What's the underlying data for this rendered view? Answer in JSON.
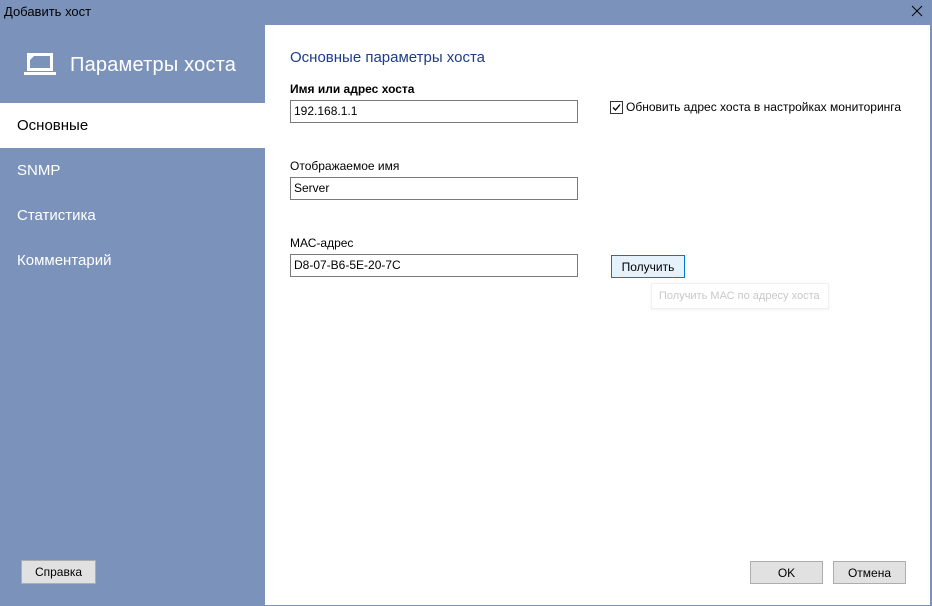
{
  "window": {
    "title": "Добавить хост"
  },
  "sidebar": {
    "header_title": "Параметры хоста",
    "items": [
      {
        "label": "Основные"
      },
      {
        "label": "SNMP"
      },
      {
        "label": "Статистика"
      },
      {
        "label": "Комментарий"
      }
    ],
    "help_label": "Справка"
  },
  "main": {
    "section_title": "Основные параметры хоста",
    "host": {
      "label": "Имя или адрес хоста",
      "value": "192.168.1.1"
    },
    "update_checkbox": {
      "label": "Обновить адрес хоста в настройках мониторинга",
      "checked": true
    },
    "display_name": {
      "label": "Отображаемое имя",
      "value": "Server"
    },
    "mac": {
      "label": "МАС-адрес",
      "value": "D8-07-B6-5E-20-7C"
    },
    "get_button_label": "Получить",
    "tooltip": "Получить МАС по адресу хоста"
  },
  "footer": {
    "ok_label": "OK",
    "cancel_label": "Отмена"
  },
  "colors": {
    "sidebar": "#7b93ba",
    "title_accent": "#1e3c8c"
  }
}
